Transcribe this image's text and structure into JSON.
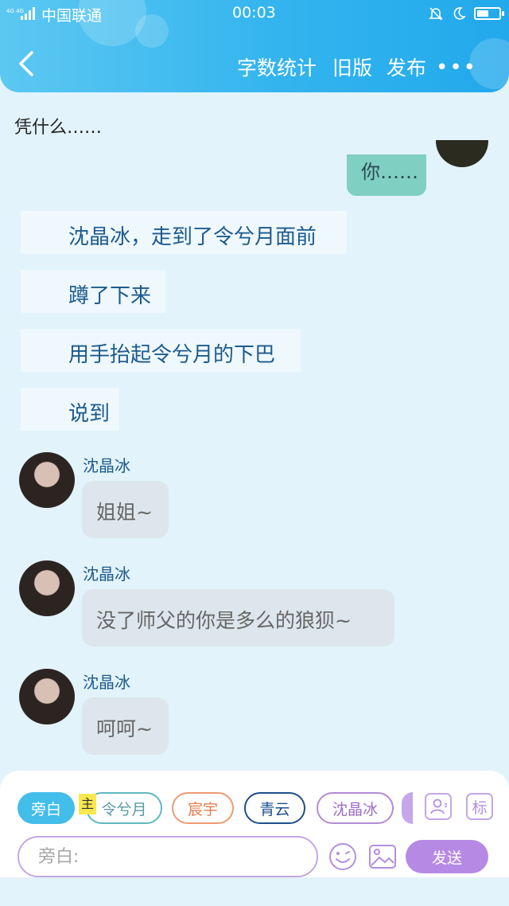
{
  "status_bar": {
    "carrier": "中国联通",
    "network": "4G 4G",
    "time": "00:03"
  },
  "nav": {
    "actions": [
      "字数统计",
      "旧版",
      "发布"
    ],
    "more": "•••"
  },
  "messages": {
    "narration_top": "凭什么……",
    "sent": "你……",
    "narrations": [
      "沈晶冰，走到了令兮月面前",
      "蹲了下来",
      "用手抬起令兮月的下巴",
      "说到"
    ],
    "chats": [
      {
        "name": "沈晶冰",
        "text": "姐姐~"
      },
      {
        "name": "沈晶冰",
        "text": "没了师父的你是多么的狼狈~"
      },
      {
        "name": "沈晶冰",
        "text": "呵呵~"
      }
    ]
  },
  "composer": {
    "roles": [
      "旁白",
      "令兮月",
      "宸宇",
      "青云",
      "沈晶冰"
    ],
    "main_tag": "主",
    "tag_icon_label": "标",
    "input_placeholder": "旁白:",
    "send_label": "发送"
  },
  "colors": {
    "header_gradient_start": "#5cc8f2",
    "header_gradient_end": "#22a9ec",
    "background": "#e2f3fb",
    "send_button": "#b68ae4"
  }
}
